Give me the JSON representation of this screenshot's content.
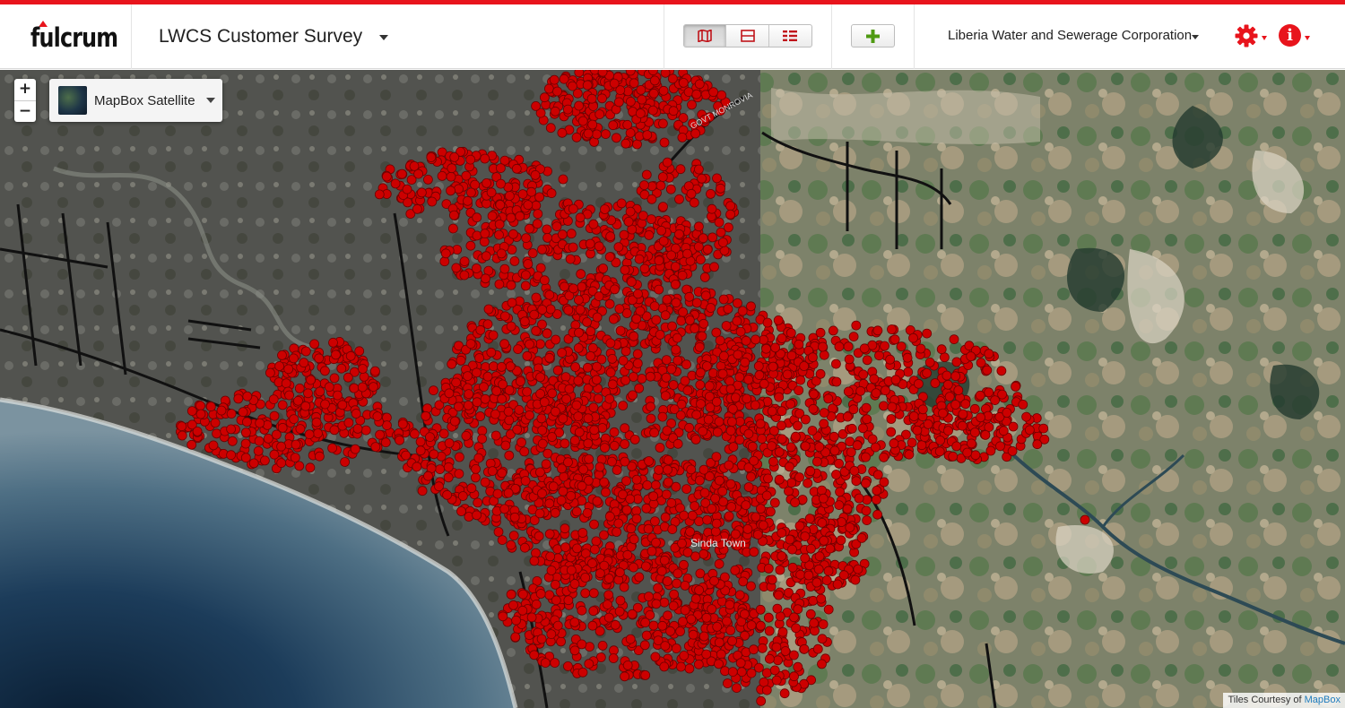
{
  "header": {
    "logo_text": "fulcrum",
    "app_title": "LWCS Customer Survey",
    "view_modes": [
      {
        "name": "map-view",
        "icon": "map-icon",
        "active": true
      },
      {
        "name": "split-view",
        "icon": "split-icon",
        "active": false
      },
      {
        "name": "list-view",
        "icon": "list-icon",
        "active": false
      }
    ],
    "add_icon": "plus-icon",
    "organization": "Liberia Water and Sewerage Corporation",
    "settings_icon": "gear-icon",
    "info_icon": "info-icon"
  },
  "map": {
    "zoom_in_label": "+",
    "zoom_out_label": "−",
    "layer_selector": "MapBox Satellite",
    "attribution_prefix": "Tiles Courtesy of",
    "attribution_link": "MapBox",
    "labels": [
      "Sinda Town",
      "GOVT MONROVIA"
    ],
    "marker_color": "#cc0000",
    "accent_color": "#e8141c"
  }
}
